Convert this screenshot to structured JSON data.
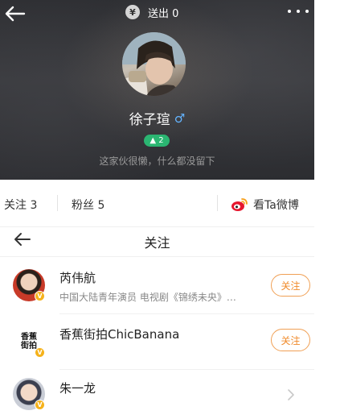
{
  "header": {
    "sent_label": "送出 0",
    "currency_symbol": "¥",
    "user_name": "徐子瑄",
    "gender_symbol": "♂",
    "level": "▲ 2",
    "bio": "这家伙很懒，什么都没留下"
  },
  "stats": {
    "following_label": "关注 3",
    "fans_label": "粉丝 5",
    "weibo_label": "看Ta微博"
  },
  "nav": {
    "title": "关注"
  },
  "follow_list": [
    {
      "name": "芮伟航",
      "desc": "中国大陆青年演员 电视剧《锦绣未央》…",
      "action": "关注"
    },
    {
      "name": "香蕉街拍ChicBanana",
      "desc": "",
      "action": "关注",
      "logo_text": "香蕉街拍"
    },
    {
      "name": "朱一龙",
      "desc": "",
      "action": ""
    }
  ],
  "colors": {
    "accent_orange": "#f08a2a",
    "level_green": "#2bb672",
    "verified_yellow": "#f5b21b"
  }
}
